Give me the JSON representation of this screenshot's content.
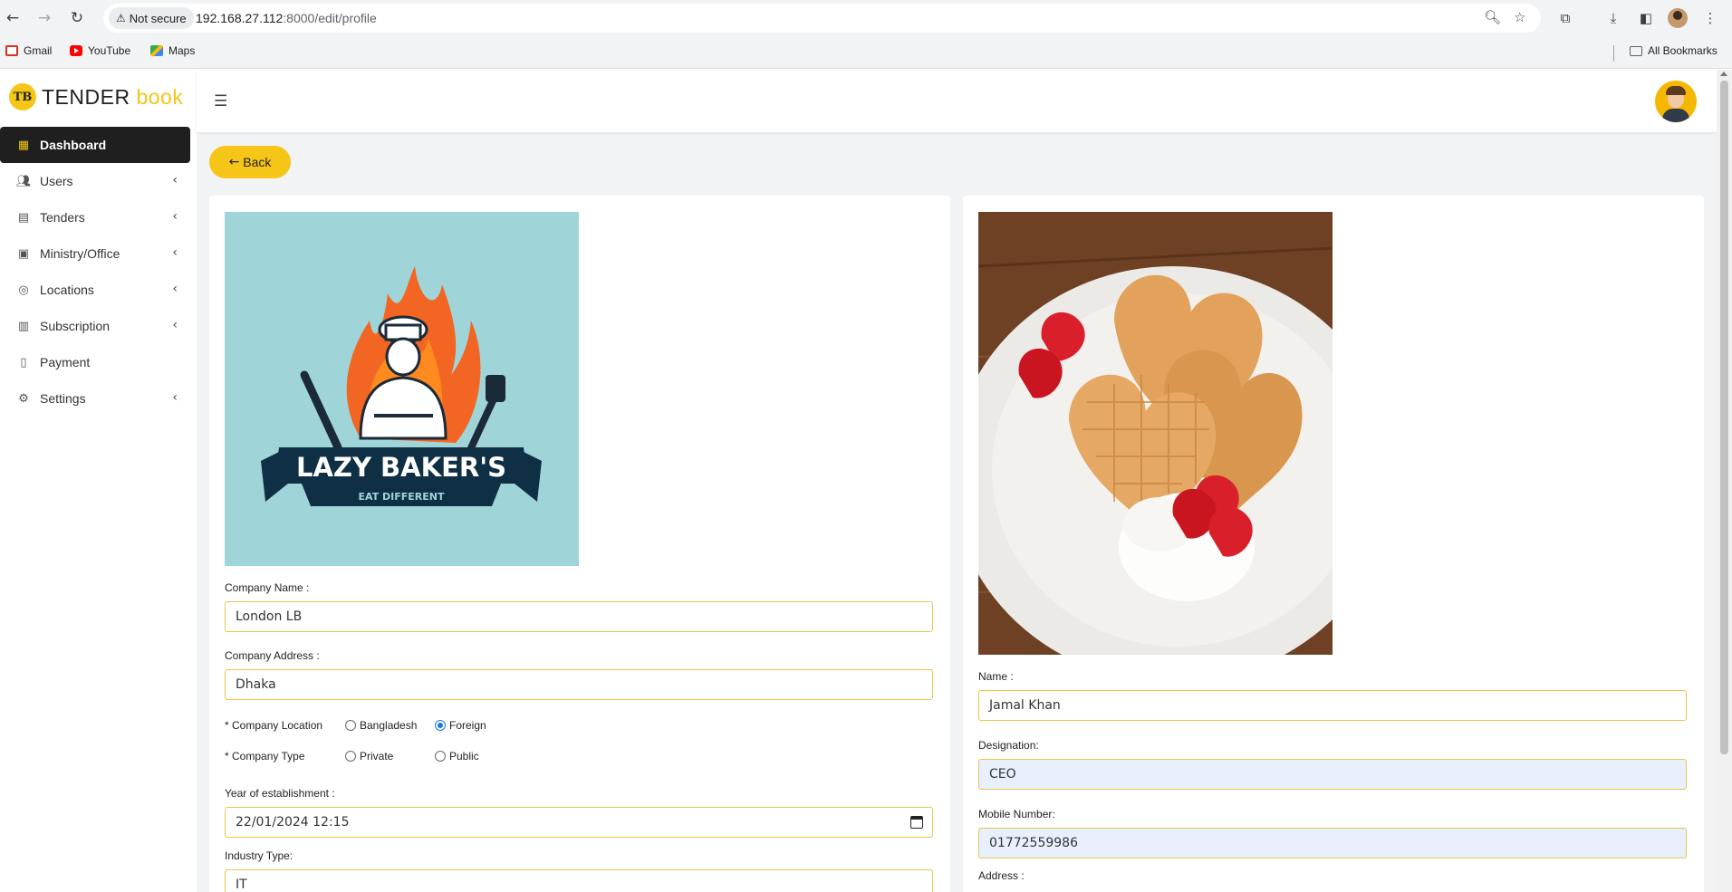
{
  "browser": {
    "security_label": "Not secure",
    "url_host": "192.168.27.112",
    "url_rest": ":8000/edit/profile",
    "bookmarks": [
      "Gmail",
      "YouTube",
      "Maps"
    ],
    "all_bookmarks": "All Bookmarks"
  },
  "brand": {
    "name_main": "TENDER",
    "name_accent": "book",
    "logo_text": "TB"
  },
  "sidebar": {
    "items": [
      {
        "label": "Dashboard",
        "icon": "grid-icon"
      },
      {
        "label": "Users",
        "icon": "users-icon"
      },
      {
        "label": "Tenders",
        "icon": "document-icon"
      },
      {
        "label": "Ministry/Office",
        "icon": "office-icon"
      },
      {
        "label": "Locations",
        "icon": "location-icon"
      },
      {
        "label": "Subscription",
        "icon": "calendar-icon"
      },
      {
        "label": "Payment",
        "icon": "payment-icon"
      },
      {
        "label": "Settings",
        "icon": "gear-icon"
      }
    ]
  },
  "page": {
    "back_label": "Back"
  },
  "company": {
    "logo_title": "LAZY BAKER'S",
    "logo_tagline": "EAT DIFFERENT",
    "name_label": "Company Name :",
    "name_value": "London LB",
    "address_label": "Company Address :",
    "address_value": "Dhaka",
    "location_label": "* Company Location",
    "location_options": [
      "Bangladesh",
      "Foreign"
    ],
    "location_selected": "Foreign",
    "type_label": "* Company Type",
    "type_options": [
      "Private",
      "Public"
    ],
    "year_label": "Year of establishment :",
    "year_value": "22/01/2024 12:15",
    "industry_label": "Industry Type:",
    "industry_value": "IT"
  },
  "person": {
    "name_label": "Name :",
    "name_value": "Jamal Khan",
    "designation_label": "Designation:",
    "designation_value": "CEO",
    "mobile_label": "Mobile Number:",
    "mobile_value": "01772559986",
    "address_label": "Address :"
  },
  "colors": {
    "accent": "#f5c518",
    "sidebar_active": "#1f1f1f",
    "input_border": "#e8c547",
    "logo_bg": "#9fd5d9"
  }
}
